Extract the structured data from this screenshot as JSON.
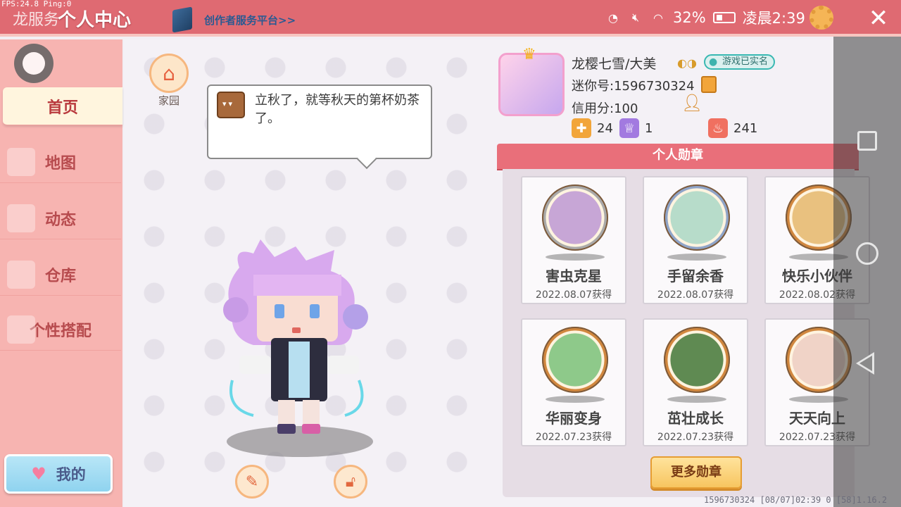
{
  "topbar": {
    "fps_text": "FPS:24.8  Ping:0",
    "title_prefix": "龙服务",
    "title": "个人中心",
    "platform_link": "创作者服务平台>>",
    "status": {
      "battery": "32%",
      "time": "凌晨2:39"
    }
  },
  "sidenav": {
    "items": [
      {
        "label": "首页",
        "active": true
      },
      {
        "label": "地图"
      },
      {
        "label": "动态"
      },
      {
        "label": "仓库"
      },
      {
        "label": "个性搭配"
      }
    ],
    "mine_label": "我的"
  },
  "home": {
    "label": "家园"
  },
  "bubble": {
    "text": "立秋了，就等秋天的第杯奶茶了。"
  },
  "profile": {
    "name": "龙樱七雪/大美",
    "realname_badge": "游戏已实名",
    "mini_id": "迷你号:1596730324",
    "credit": "信用分:100",
    "stats": {
      "flower": "24",
      "cup": "1",
      "fire": "241"
    }
  },
  "medals": {
    "header": "个人勋章",
    "items": [
      {
        "name": "害虫克星",
        "date": "2022.08.07获得",
        "ring": "#a9a9a9",
        "core": "#c7a6d6"
      },
      {
        "name": "手留余香",
        "date": "2022.08.07获得",
        "ring": "#8fa4c8",
        "core": "#b7dcca"
      },
      {
        "name": "快乐小伙伴",
        "date": "2022.08.02获得",
        "ring": "#d1873e",
        "core": "#e9c17f"
      },
      {
        "name": "华丽变身",
        "date": "2022.07.23获得",
        "ring": "#d1873e",
        "core": "#8ec98a"
      },
      {
        "name": "茁壮成长",
        "date": "2022.07.23获得",
        "ring": "#d1873e",
        "core": "#5f8a52"
      },
      {
        "name": "天天向上",
        "date": "2022.07.23获得",
        "ring": "#d1873e",
        "core": "#f0d3c7"
      }
    ],
    "more_label": "更多勋章"
  },
  "footer": {
    "debug_text": "1596730324   [08/07]02:39 0   [58]1.16.2"
  },
  "colors": {
    "topbar": "#df6a72",
    "sidenav": "#f7b4b1",
    "accent": "#e96f7a"
  }
}
